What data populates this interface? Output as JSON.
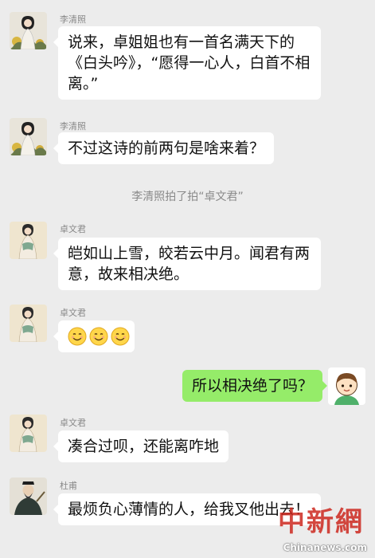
{
  "messages": [
    {
      "sender": "李清照",
      "text": "说来，卓姐姐也有一首名满天下的《白头吟》，“愿得一心人，白首不相离。”"
    },
    {
      "sender": "李清照",
      "text": "不过这诗的前两句是啥来着？"
    },
    {
      "system": "李清照拍了拍“卓文君”"
    },
    {
      "sender": "卓文君",
      "text": "皑如山上雪，皎若云中月。闻君有两意，故来相决绝。"
    },
    {
      "sender": "卓文君",
      "emoji": [
        "smile-emoji",
        "smile-emoji",
        "smile-emoji"
      ]
    },
    {
      "self": true,
      "text": "所以相决绝了吗？"
    },
    {
      "sender": "卓文君",
      "text": "凑合过呗，还能离咋地"
    },
    {
      "sender": "杜甫",
      "text": "最烦负心薄情的人，给我叉他出去！"
    }
  ],
  "watermark": {
    "cn": "中新網",
    "url": "Chinanews.com"
  },
  "colors": {
    "background": "#ececec",
    "bubble_in": "#ffffff",
    "bubble_out": "#95ec69"
  }
}
